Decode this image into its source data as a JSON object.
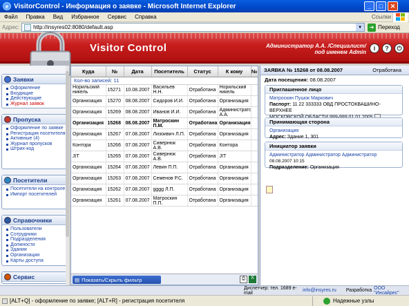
{
  "window": {
    "title": "VisitorControl - Информация о заявке - Microsoft Internet Explorer"
  },
  "menu": {
    "items": [
      "Файл",
      "Правка",
      "Вид",
      "Избранное",
      "Сервис",
      "Справка"
    ],
    "links_label": "Ссылки"
  },
  "address": {
    "label": "Адрес:",
    "url": "http://insyres02:8080/default.asp",
    "go_label": "Переход"
  },
  "header": {
    "app_title": "Visitor Control",
    "user_line1": "Администратор А.А. /Специалист/",
    "user_line2": "под именем Admin"
  },
  "sidebar": {
    "sections": [
      {
        "title": "Заявки",
        "items": [
          "Оформление",
          "Входящие",
          "Действующие",
          "Журнал заявок"
        ]
      },
      {
        "title": "Пропуска",
        "items": [
          "Оформление по заявке",
          "Регистрация посетителя",
          "Активные (4)",
          "Журнал пропусков",
          "Штрих-код"
        ]
      },
      {
        "title": "Посетители",
        "items": [
          "Посетители на контроле",
          "Импорт посетителей"
        ]
      },
      {
        "title": "Справочники",
        "items": [
          "Пользователи",
          "Сотрудники",
          "Подразделения",
          "Должности",
          "Здания",
          "Организации",
          "Карты доступа"
        ]
      },
      {
        "title": "Сервис",
        "items": []
      }
    ]
  },
  "grid": {
    "columns": [
      "Куда",
      "№",
      "Дата",
      "Посетитель",
      "Статус",
      "К кому",
      "№"
    ],
    "count_label": "Кол-во записей: 11",
    "rows": [
      [
        "Норильский никель",
        "15271",
        "10.08.2007",
        "Васильев Н.Н.",
        "Отработана",
        "Норильский никель"
      ],
      [
        "Организация",
        "15270",
        "08.08.2007",
        "Сидоров И.И.",
        "Отработана",
        "Организация"
      ],
      [
        "Организация",
        "15269",
        "08.08.2007",
        "Иванов И.И.",
        "Отработана",
        "Администратор А.А."
      ],
      [
        "Организация",
        "15268",
        "08.08.2007",
        "Матроскин П.М.",
        "Отработана",
        "Организация"
      ],
      [
        "Организация",
        "15267",
        "07.08.2007",
        "Лизоивич Л.П.",
        "Отработана",
        "Организация"
      ],
      [
        "Контора",
        "15266",
        "07.08.2007",
        "Сивернюк А.В.",
        "Отработана",
        "Контора"
      ],
      [
        "JIT",
        "15265",
        "07.08.2007",
        "Сивернюк А.В.",
        "Отработана",
        "JIT"
      ],
      [
        "Организация",
        "15264",
        "07.08.2007",
        "Левин П.П.",
        "Отработана",
        "Организация"
      ],
      [
        "Организация",
        "15263",
        "07.08.2007",
        "Семенов Р.С.",
        "Отработана",
        "Организация"
      ],
      [
        "Организация",
        "15262",
        "07.08.2007",
        "gggg Л.П.",
        "Отработана",
        "Организация"
      ],
      [
        "Организация",
        "15261",
        "07.08.2007",
        "Матроскин П.П.",
        "Отработана",
        "Организация"
      ]
    ],
    "filter_button": "Показать/Скрыть фильтр"
  },
  "detail": {
    "header": "ЗАЯВКА № 15268 от 08.08.2007",
    "status": "Отработана",
    "visit_date_label": "Дата посещения:",
    "visit_date": "08.08.2007",
    "guest_title": "Приглашенное лицо",
    "guest_name": "Матроскин Пушок Маркович",
    "passport_label": "Паспорт:",
    "passport": "11 22 333333 ОВД ПРОСТОКВАШИНО-ВЕРХНЕЕ",
    "passport2": "МОСКОВСКОЙ ОБЛАСТИ 999-999 01.01.2005",
    "host_title": "Принимающая сторона",
    "host_org": "Организация",
    "address_label": "Адрес:",
    "address": "Здание 1, 301",
    "initiator_title": "Инициатор заявки",
    "initiator": "Администратор Администратор Администратор",
    "initiator_date": "08.08.2007 10:15",
    "division_label": "Подразделение:",
    "division": "Организация"
  },
  "footer": {
    "dispatcher": "Диспетчер:  тел. 1689  e-mail",
    "email": "info@insyres.ru",
    "developer_label": "Разработка",
    "developer": "ООО \"Инсайрес\""
  },
  "status": {
    "hint": "[ALT+Q] - оформление по заявке; [ALT+R] - регистрация посетителя",
    "zone": "Надежные узлы"
  }
}
